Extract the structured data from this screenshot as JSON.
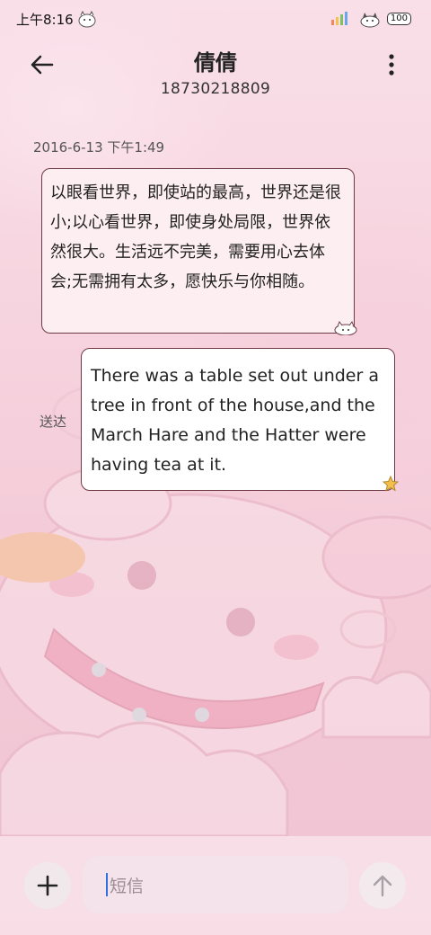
{
  "status_bar": {
    "time": "上午8:16",
    "battery": "100"
  },
  "header": {
    "contact_name": "倩倩",
    "phone_number": "18730218809",
    "back_icon": "arrow-left-icon",
    "more_icon": "more-vertical-icon"
  },
  "conversation": {
    "timestamp": "2016-6-13 下午1:49",
    "messages": [
      {
        "direction": "incoming",
        "text": "以眼看世界，即使站的最高，世界还是很小;以心看世界，即使身处局限，世界依然很大。生活远不完美，需要用心去体会;无需拥有太多，愿快乐与你相随。"
      },
      {
        "direction": "outgoing",
        "text": "There was a table set out under a tree in front of the house,and the March Hare and the Hatter were having tea at it.",
        "status": "送达"
      }
    ]
  },
  "composer": {
    "placeholder": "短信",
    "add_icon": "plus-icon",
    "send_icon": "arrow-up-icon"
  },
  "colors": {
    "background": "#f7d6e1",
    "bubble_border": "#6e3a45",
    "caret": "#2f6fe0"
  }
}
